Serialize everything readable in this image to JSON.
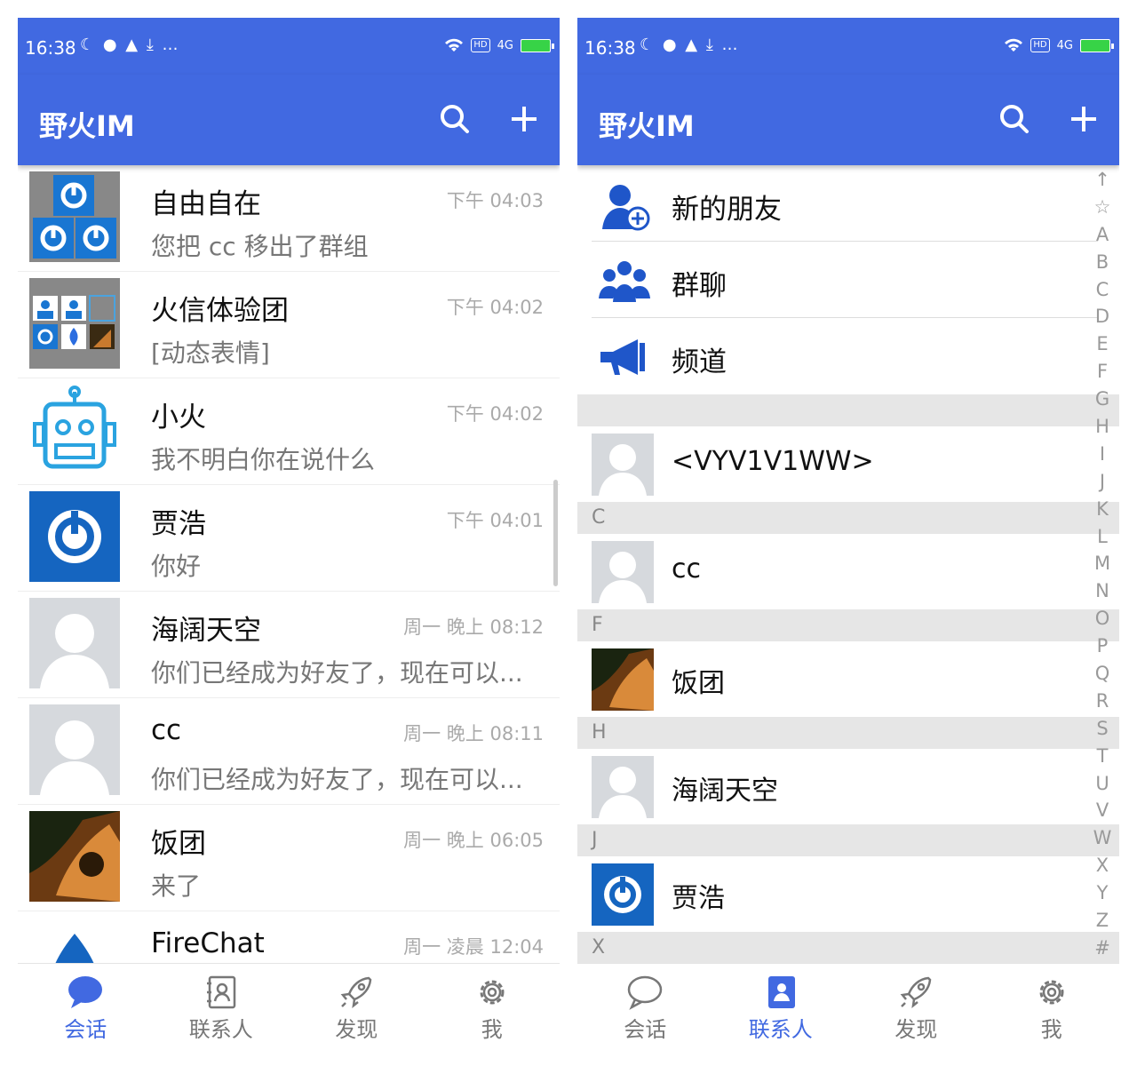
{
  "status_bar": {
    "time": "16:38",
    "left_icons": "☾ ● ▲ ⤓ …",
    "network": "4G",
    "hd": "HD"
  },
  "left_screen": {
    "app_title": "野火IM",
    "conversations": [
      {
        "name": "自由自在",
        "message": "您把 cc 移出了群组",
        "time": "下午 04:03",
        "avatar": "group-avatar"
      },
      {
        "name": "火信体验团",
        "message": "[动态表情]",
        "time": "下午 04:02",
        "avatar": "group-avatar"
      },
      {
        "name": "小火",
        "message": "我不明白你在说什么",
        "time": "下午 04:02",
        "avatar": "robot-avatar"
      },
      {
        "name": "贾浩",
        "message": "你好",
        "time": "下午 04:01",
        "avatar": "power-avatar"
      },
      {
        "name": "海阔天空",
        "message": "你们已经成为好友了，现在可以...",
        "time": "周一 晚上 08:12",
        "avatar": "default-avatar"
      },
      {
        "name": "cc",
        "message": "你们已经成为好友了，现在可以...",
        "time": "周一 晚上 08:11",
        "avatar": "default-avatar"
      },
      {
        "name": "饭团",
        "message": "来了",
        "time": "周一 晚上 06:05",
        "avatar": "photo-avatar"
      },
      {
        "name": "FireChat",
        "message": "",
        "time": "周一 凌晨 12:04",
        "avatar": "fire-avatar"
      }
    ],
    "tabs": [
      {
        "label": "会话",
        "active": true
      },
      {
        "label": "联系人"
      },
      {
        "label": "发现"
      },
      {
        "label": "我"
      }
    ]
  },
  "right_screen": {
    "app_title": "野火IM",
    "fixed_entries": [
      {
        "label": "新的朋友",
        "icon": "add-friend-icon"
      },
      {
        "label": "群聊",
        "icon": "group-icon"
      },
      {
        "label": "频道",
        "icon": "megaphone-icon"
      }
    ],
    "sections": [
      {
        "header": "",
        "contacts": [
          {
            "name": "<VYV1V1WW>",
            "avatar": "default-avatar"
          }
        ]
      },
      {
        "header": "C",
        "contacts": [
          {
            "name": "cc",
            "avatar": "default-avatar"
          }
        ]
      },
      {
        "header": "F",
        "contacts": [
          {
            "name": "饭团",
            "avatar": "photo-avatar"
          }
        ]
      },
      {
        "header": "H",
        "contacts": [
          {
            "name": "海阔天空",
            "avatar": "default-avatar"
          }
        ]
      },
      {
        "header": "J",
        "contacts": [
          {
            "name": "贾浩",
            "avatar": "power-avatar"
          }
        ]
      },
      {
        "header": "X",
        "contacts": []
      }
    ],
    "index_letters": [
      "↑",
      "☆",
      "A",
      "B",
      "C",
      "D",
      "E",
      "F",
      "G",
      "H",
      "I",
      "J",
      "K",
      "L",
      "M",
      "N",
      "O",
      "P",
      "Q",
      "R",
      "S",
      "T",
      "U",
      "V",
      "W",
      "X",
      "Y",
      "Z",
      "#"
    ],
    "tabs": [
      {
        "label": "会话"
      },
      {
        "label": "联系人",
        "active": true
      },
      {
        "label": "发现"
      },
      {
        "label": "我"
      }
    ]
  },
  "colors": {
    "primary": "#4169e1",
    "battery": "#37d347",
    "muted": "#777777",
    "section_bg": "#e6e6e6"
  }
}
